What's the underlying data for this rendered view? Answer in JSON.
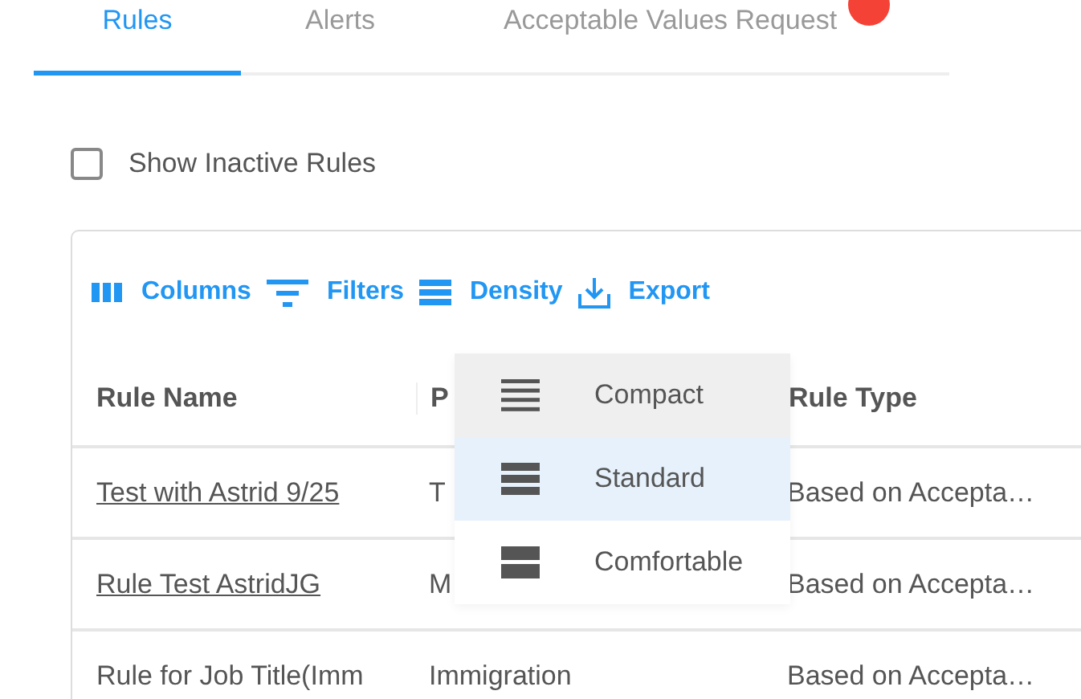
{
  "tabs": [
    {
      "label": "Rules",
      "selected": true,
      "badge": false
    },
    {
      "label": "Alerts",
      "selected": false,
      "badge": false
    },
    {
      "label": "Acceptable Values Request",
      "selected": false,
      "badge": true
    }
  ],
  "show_inactive": {
    "label": "Show Inactive Rules",
    "checked": false
  },
  "toolbar": [
    {
      "kind": "columns",
      "label": "Columns"
    },
    {
      "kind": "filters",
      "label": "Filters"
    },
    {
      "kind": "density",
      "label": "Density"
    },
    {
      "kind": "export",
      "label": "Export"
    }
  ],
  "table": {
    "columns": [
      "Rule Name",
      "P",
      "Rule Type"
    ],
    "rows": [
      {
        "cells": [
          "Test with Astrid 9/25",
          "T",
          "Based on Accepta…"
        ],
        "link": true
      },
      {
        "cells": [
          "Rule Test AstridJG",
          "M",
          "Based on Accepta…"
        ],
        "link": true
      },
      {
        "cells": [
          "Rule for Job Title(Imm",
          "Immigration",
          "Based on Accepta…"
        ],
        "link": false
      }
    ]
  },
  "density_menu": [
    {
      "kind": "compact",
      "label": "Compact",
      "selected": false,
      "hovered": true
    },
    {
      "kind": "standard",
      "label": "Standard",
      "selected": true,
      "hovered": false
    },
    {
      "kind": "comfortable",
      "label": "Comfortable",
      "selected": false,
      "hovered": false
    }
  ]
}
